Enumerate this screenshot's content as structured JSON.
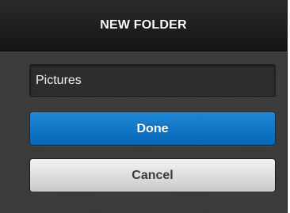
{
  "dialog": {
    "title": "NEW FOLDER",
    "folder_name_value": "Pictures",
    "done_label": "Done",
    "cancel_label": "Cancel"
  },
  "colors": {
    "primary_button": "#0a74c8",
    "secondary_button": "#dcdcdc",
    "background": "#3a3a3a"
  }
}
